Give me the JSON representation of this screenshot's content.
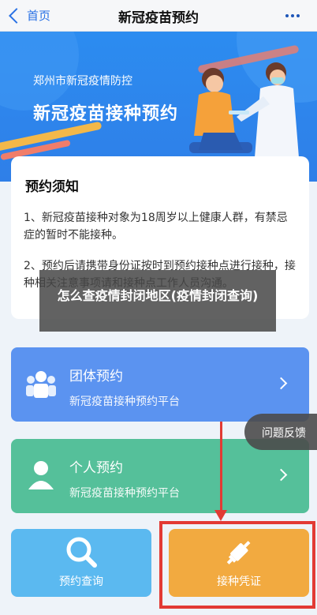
{
  "nav": {
    "back_label": "首页",
    "title": "新冠疫苗预约"
  },
  "banner": {
    "city_line": "郑州市新冠疫情防控",
    "headline": "新冠疫苗接种预约"
  },
  "notice": {
    "heading": "预约须知",
    "item1": "1、新冠疫苗接种对象为18周岁以上健康人群，有禁忌症的暂时不能接种。",
    "item2": "2、预约后请携带身份证按时到预约接种点进行接种，接种相关注意事项请和接种点工作人员沟通。"
  },
  "overlay_caption": "怎么查疫情封闭地区(疫情封闭查询)",
  "cards": {
    "group": {
      "name": "团体预约",
      "desc": "新冠疫苗接种预约平台"
    },
    "personal": {
      "name": "个人预约",
      "desc": "新冠疫苗接种预约平台"
    }
  },
  "bottom": {
    "query": "预约查询",
    "certificate": "接种凭证"
  },
  "feedback": "问题反馈",
  "colors": {
    "accent_blue": "#2a72e5",
    "group_card": "#5b93f0",
    "personal_card": "#55c09a",
    "query_tile": "#5bb9f0",
    "cert_tile": "#f2aa40",
    "highlight_red": "#e23a34"
  },
  "icons": [
    "back-chevron-icon",
    "more-dots-icon",
    "group-people-icon",
    "person-icon",
    "chevron-right-icon",
    "search-icon",
    "syringe-icon"
  ]
}
